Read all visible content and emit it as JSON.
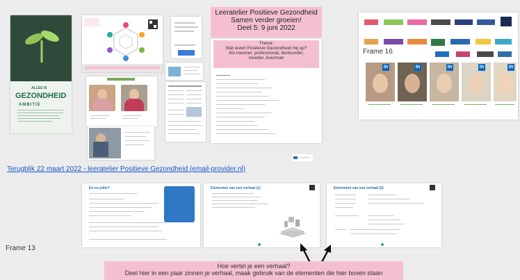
{
  "canvas": {
    "background": "#ececec",
    "accent_pink": "#f5bfd2",
    "link_color": "#1a56c9"
  },
  "title_box": {
    "line1": "Leeratelier Positieve Gezondheid",
    "line2": "Samen verder groeien!",
    "line3": "Deel 5: 9 juni 2022"
  },
  "theme_box": {
    "label": "Thema:",
    "line1": "Wat levert Positieve Gezondheid mij op?",
    "line2": "Als inwoner, professional, bestuurder,",
    "line3": "moeder, buurman"
  },
  "poster": {
    "brand_small": "ALLES IS",
    "brand_big": "GEZONDHEID",
    "subtitle": "AMBITIE"
  },
  "frame16": {
    "label": "Frame 16"
  },
  "frame13": {
    "label": "Frame 13"
  },
  "link": {
    "text": "Terugblik 22 maart 2022 - leeratelier Positieve Gezondheid (email-provider.nl)"
  },
  "bottom_banner": {
    "line1": "Hoe vertel je een verhaal?",
    "line2": "Deel hier in een paar zinnen je verhaal, maak gebruik van de elementen die hier boven staan"
  },
  "slides": {
    "s1_title": "En nu jullie?",
    "s2_title": "Elementen van een verhaal (1)",
    "s3_title": "Elementen van een verhaal (2)"
  },
  "icons": {
    "linkedin": "linkedin-icon",
    "arrow": "arrow-up-icon",
    "sprout": "sprout-icon"
  }
}
